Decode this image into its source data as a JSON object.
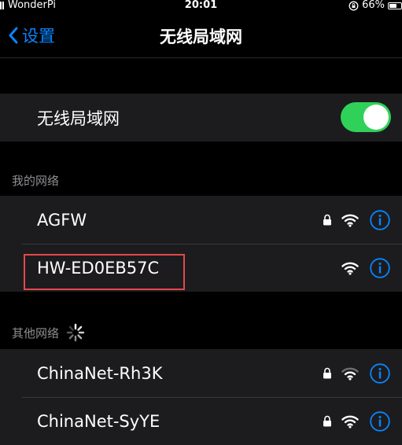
{
  "status_bar": {
    "carrier": "WonderPi",
    "time": "20:01",
    "battery": "66%",
    "battery_level": 0.66
  },
  "nav": {
    "back_label": "设置",
    "title": "无线局域网"
  },
  "wifi_toggle": {
    "label": "无线局域网",
    "on": true
  },
  "my_networks": {
    "header": "我的网络",
    "items": [
      {
        "name": "AGFW",
        "locked": true,
        "signal": "full"
      },
      {
        "name": "HW-ED0EB57C",
        "locked": false,
        "signal": "full"
      }
    ]
  },
  "other_networks": {
    "header": "其他网络",
    "items": [
      {
        "name": "ChinaNet-Rh3K",
        "locked": true,
        "signal": "medium"
      },
      {
        "name": "ChinaNet-SyYE",
        "locked": true,
        "signal": "full"
      }
    ]
  },
  "colors": {
    "accent": "#0a84ff",
    "toggle_on": "#30d158",
    "highlight": "#e5484d"
  },
  "icons": {
    "back": "chevron-left-icon",
    "lock": "lock-icon",
    "wifi": "wifi-icon",
    "info": "info-icon",
    "spinner": "loading-spinner-icon",
    "orientation_lock": "orientation-lock-icon",
    "battery": "battery-icon"
  }
}
